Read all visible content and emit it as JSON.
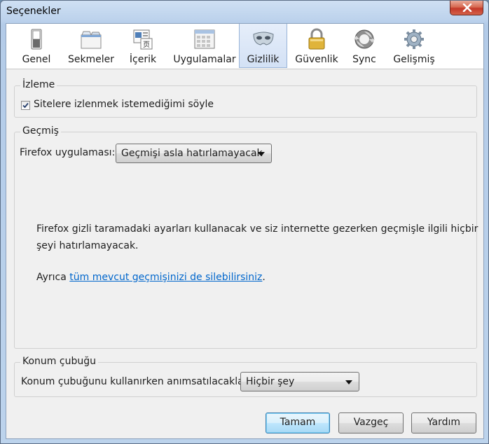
{
  "window": {
    "title": "Seçenekler"
  },
  "toolbar": {
    "items": [
      {
        "label": "Genel",
        "icon": "switch-icon"
      },
      {
        "label": "Sekmeler",
        "icon": "tabs-icon"
      },
      {
        "label": "İçerik",
        "icon": "content-icon"
      },
      {
        "label": "Uygulamalar",
        "icon": "applications-icon"
      },
      {
        "label": "Gizlilik",
        "icon": "mask-icon",
        "selected": true
      },
      {
        "label": "Güvenlik",
        "icon": "lock-icon"
      },
      {
        "label": "Sync",
        "icon": "sync-icon"
      },
      {
        "label": "Gelişmiş",
        "icon": "gear-icon"
      }
    ]
  },
  "tracking": {
    "legend": "İzleme",
    "checkbox_label": "Sitelere izlenmek istemediğimi söyle",
    "checked": true
  },
  "history": {
    "legend": "Geçmiş",
    "firefox_label": "Firefox uygulaması:",
    "dropdown_value": "Geçmişi asla hatırlamayacak",
    "description_line1": "Firefox gizli taramadaki ayarları kullanacak ve siz internette gezerken geçmişle ilgili hiçbir",
    "description_line2": "şeyi hatırlamayacak.",
    "also_prefix": "Ayrıca ",
    "also_link": "tüm mevcut geçmişinizi de silebilirsiniz",
    "also_suffix": "."
  },
  "location_bar": {
    "legend": "Konum çubuğu",
    "label": "Konum çubuğunu kullanırken anımsatılacaklar:",
    "dropdown_value": "Hiçbir şey"
  },
  "buttons": {
    "ok": "Tamam",
    "cancel": "Vazgeç",
    "help": "Yardım"
  },
  "colors": {
    "link": "#0066cc",
    "selected_tab": "#d3e1f5",
    "close_button": "#c4392a"
  }
}
